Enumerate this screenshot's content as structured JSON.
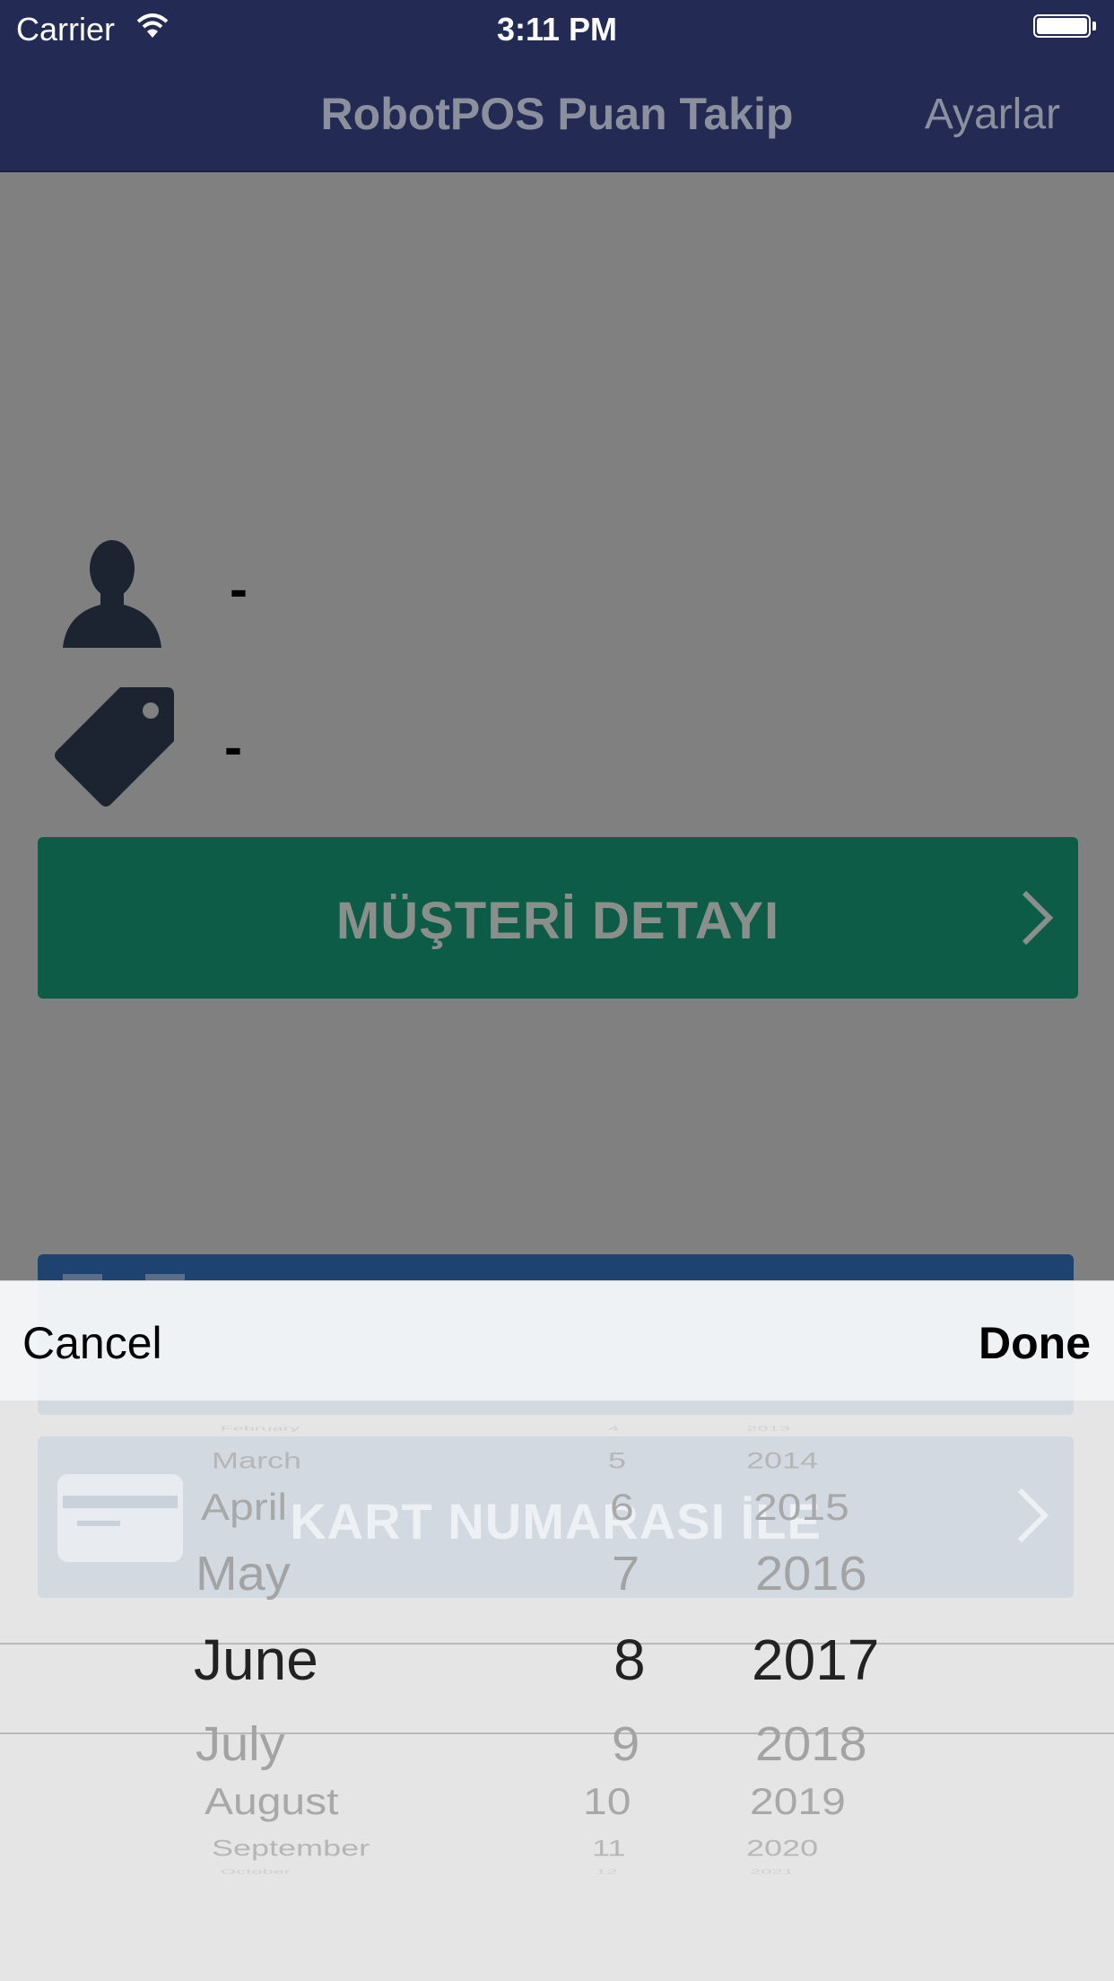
{
  "status_bar": {
    "carrier": "Carrier",
    "time": "3:11 PM"
  },
  "nav": {
    "title": "RobotPOS Puan Takip",
    "settings": "Ayarlar"
  },
  "customer": {
    "name_value": "-",
    "points_value": "-"
  },
  "detail_button": {
    "label": "MÜŞTERİ DETAYI"
  },
  "card_button": {
    "label": "KART NUMARASI İLE"
  },
  "toolbar": {
    "cancel": "Cancel",
    "done": "Done"
  },
  "date_picker": {
    "months": [
      "February",
      "March",
      "April",
      "May",
      "June",
      "July",
      "August",
      "September",
      "October"
    ],
    "days": [
      "4",
      "5",
      "6",
      "7",
      "8",
      "9",
      "10",
      "11",
      "12"
    ],
    "years": [
      "2013",
      "2014",
      "2015",
      "2016",
      "2017",
      "2018",
      "2019",
      "2020",
      "2021"
    ],
    "selected": {
      "month": "June",
      "day": "8",
      "year": "2017"
    }
  }
}
